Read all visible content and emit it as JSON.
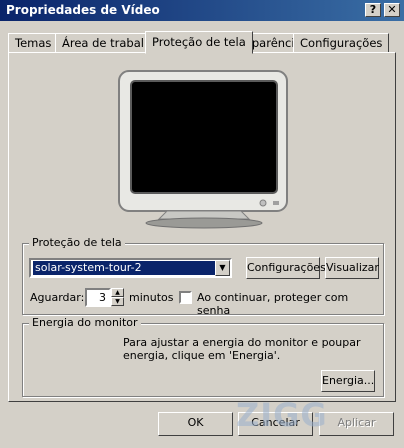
{
  "window": {
    "title": "Propriedades de Vídeo",
    "help_label": "?",
    "close_label": "✕"
  },
  "tabs": [
    {
      "label": "Temas"
    },
    {
      "label": "Área de trabalho"
    },
    {
      "label": "Proteção de tela"
    },
    {
      "label": "Aparência"
    },
    {
      "label": "Configurações"
    }
  ],
  "screensaver": {
    "group_label": "Proteção de tela",
    "selected": "solar-system-tour-2",
    "settings_button": "Configurações",
    "preview_button": "Visualizar",
    "wait_label": "Aguardar:",
    "wait_value": "3",
    "wait_unit": "minutos",
    "password_checkbox_label": "Ao continuar, proteger com senha",
    "password_checked": false
  },
  "power": {
    "group_label": "Energia do monitor",
    "description": "Para ajustar a energia do monitor e poupar energia, clique em 'Energia'.",
    "button": "Energia..."
  },
  "footer": {
    "ok": "OK",
    "cancel": "Cancelar",
    "apply": "Aplicar"
  },
  "watermark": "ZIGG",
  "colors": {
    "titlebar": "#0a246a",
    "selection": "#0a246a",
    "face": "#d4d0c8"
  }
}
